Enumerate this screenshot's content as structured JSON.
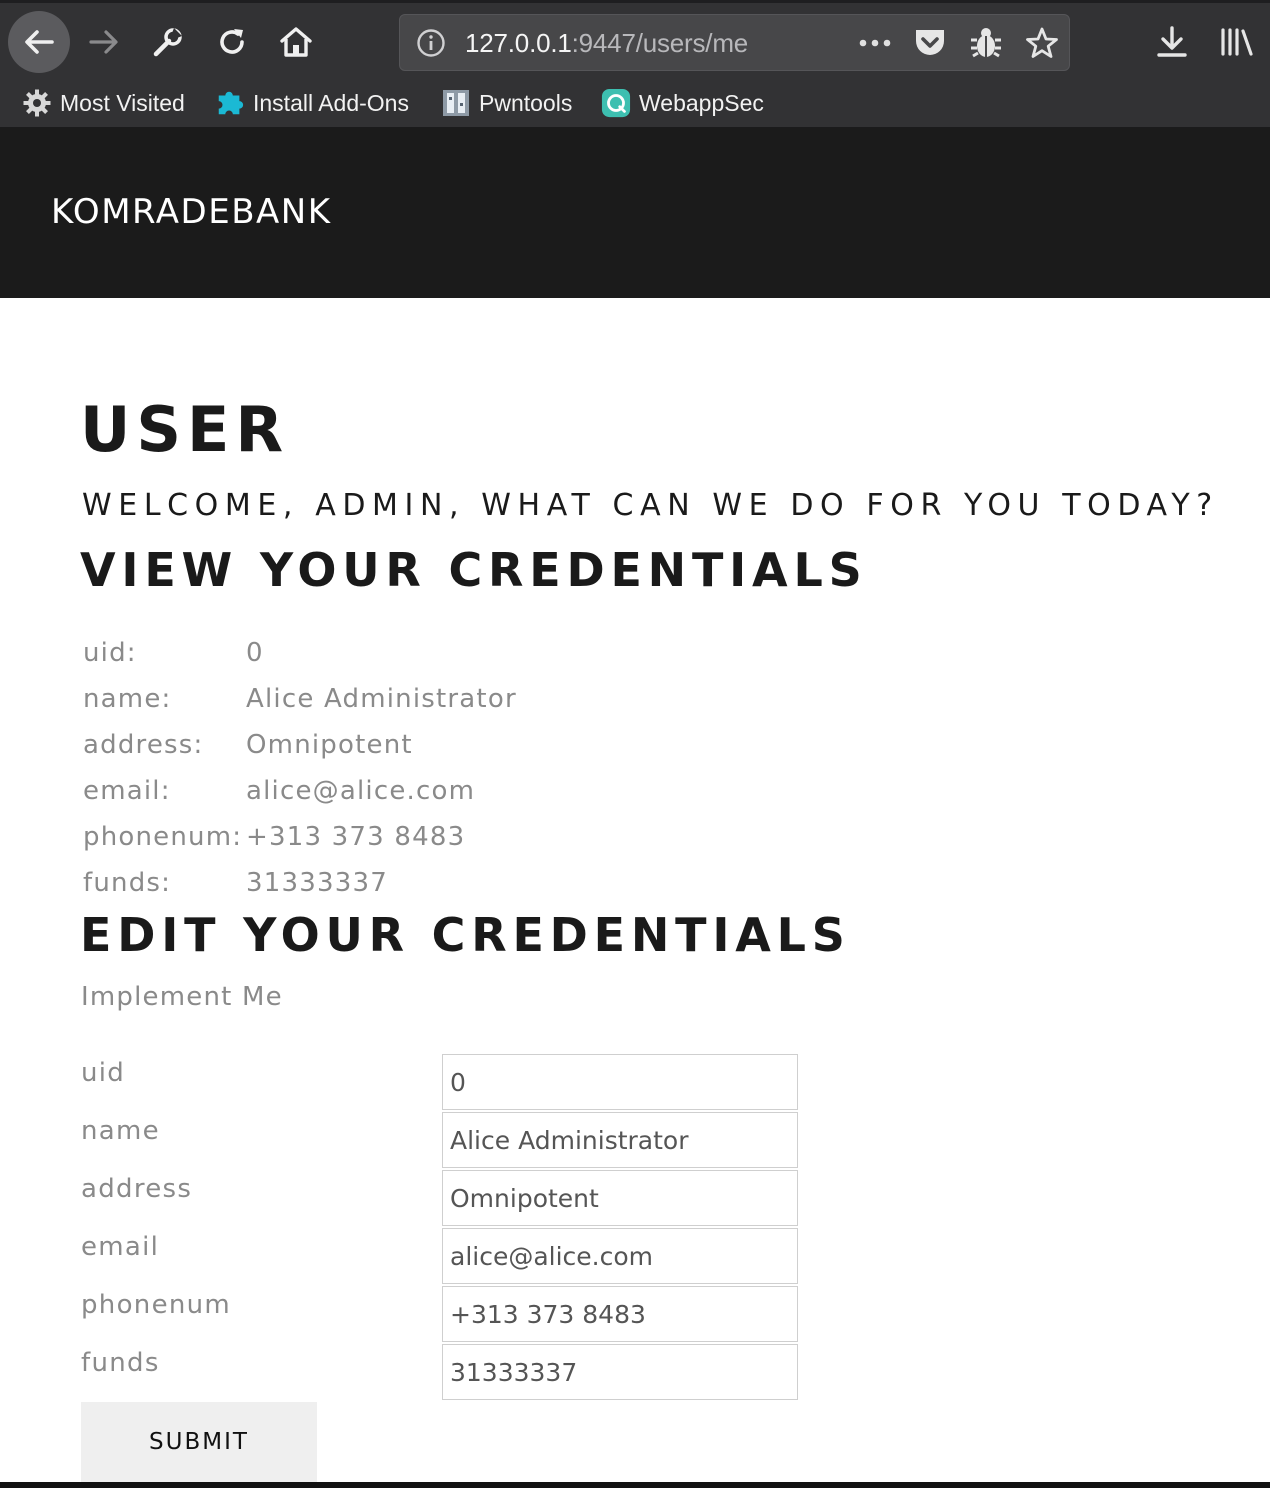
{
  "browser": {
    "url": {
      "host": "127.0.0.1",
      "rest": ":9447/users/me"
    },
    "bookmarks": [
      {
        "label": "Most Visited",
        "icon": "gear-icon"
      },
      {
        "label": "Install Add-Ons",
        "icon": "puzzle-icon"
      },
      {
        "label": "Pwntools",
        "icon": "pwntools-icon"
      },
      {
        "label": "WebappSec",
        "icon": "webappsec-icon"
      }
    ]
  },
  "site": {
    "brand": "KOMRADEBANK"
  },
  "page": {
    "title": "USER",
    "welcome": "WELCOME, ADMIN, WHAT CAN WE DO FOR YOU TODAY?",
    "view_heading": "VIEW YOUR CREDENTIALS",
    "credentials": [
      {
        "key": "uid:",
        "value": "0"
      },
      {
        "key": "name:",
        "value": "Alice Administrator"
      },
      {
        "key": "address:",
        "value": "Omnipotent"
      },
      {
        "key": "email:",
        "value": "alice@alice.com"
      },
      {
        "key": "phonenum:",
        "value": "+313 373 8483"
      },
      {
        "key": "funds:",
        "value": "31333337"
      }
    ],
    "edit_heading": "EDIT YOUR CREDENTIALS",
    "implement_note": "Implement Me",
    "form": {
      "fields": [
        {
          "label": "uid",
          "value": "0"
        },
        {
          "label": "name",
          "value": "Alice Administrator"
        },
        {
          "label": "address",
          "value": "Omnipotent"
        },
        {
          "label": "email",
          "value": "alice@alice.com"
        },
        {
          "label": "phonenum",
          "value": "+313 373 8483"
        },
        {
          "label": "funds",
          "value": "31333337"
        }
      ],
      "submit_label": "SUBMIT"
    }
  }
}
